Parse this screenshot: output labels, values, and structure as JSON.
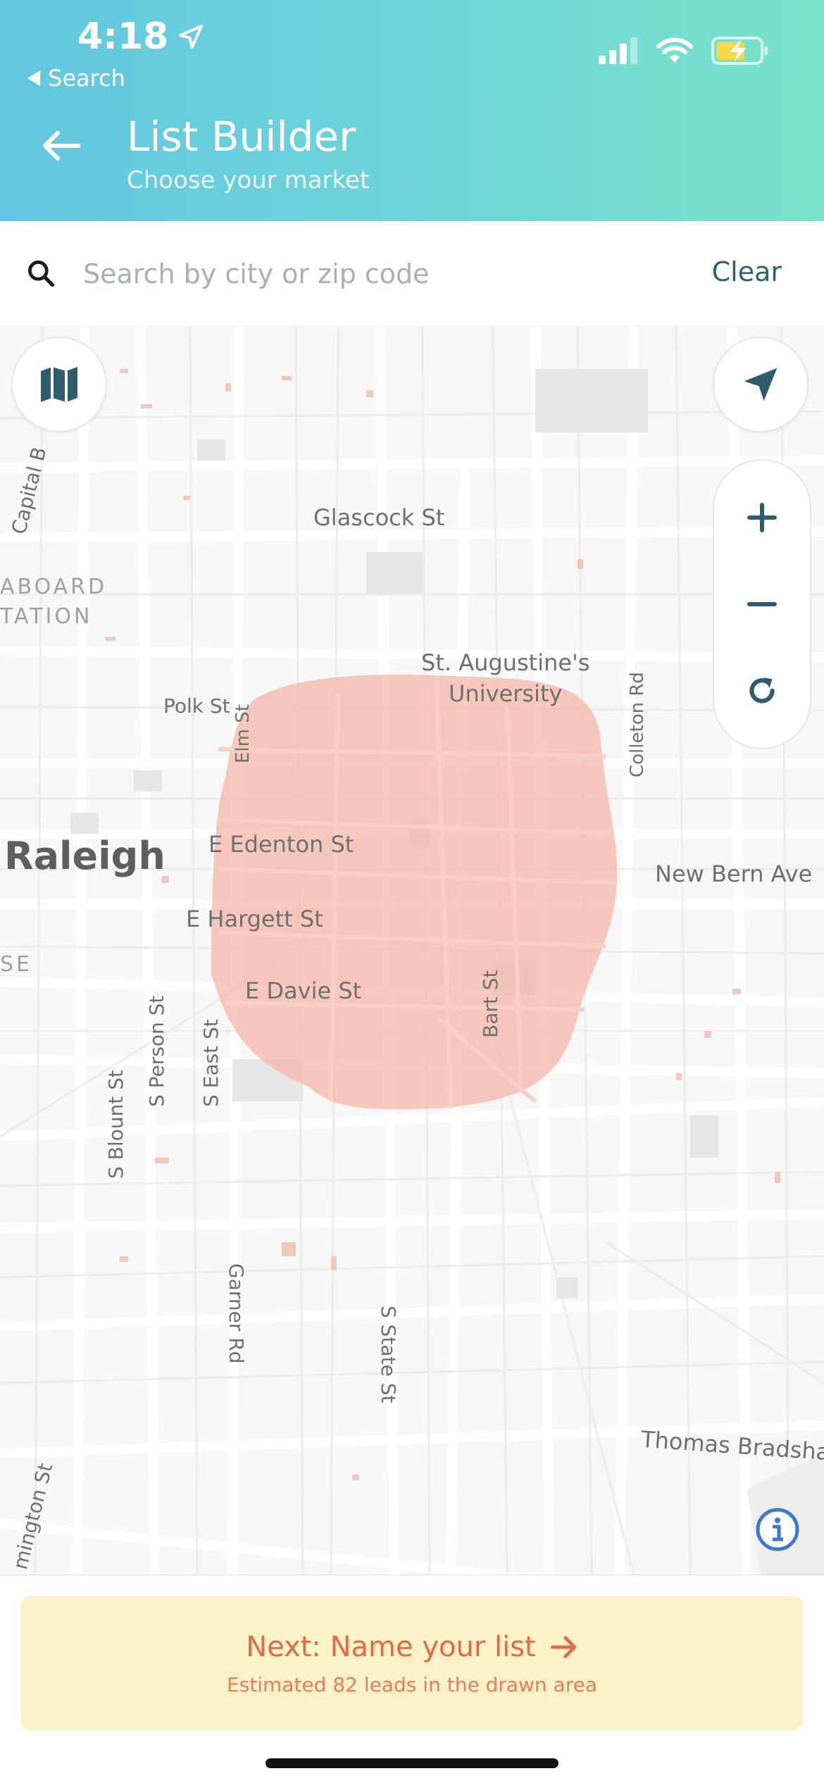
{
  "status": {
    "time": "4:18",
    "back_app": "Search",
    "icons": [
      "location-arrow-icon",
      "signal-icon",
      "wifi-icon",
      "battery-charging-icon"
    ]
  },
  "header": {
    "title": "List Builder",
    "subtitle": "Choose your market"
  },
  "search": {
    "placeholder": "Search by city or zip code",
    "value": "",
    "clear_label": "Clear"
  },
  "map": {
    "labels": {
      "glascock": "Glascock St",
      "staug1": "St. Augustine's",
      "staug2": "University",
      "polk": "Polk St",
      "elm": "Elm St",
      "colleton": "Colleton Rd",
      "raleigh": "Raleigh",
      "edenton": "E Edenton St",
      "newbern": "New Bern Ave",
      "hargett": "E Hargett St",
      "davie": "E Davie St",
      "bart": "Bart St",
      "blount": "S Blount St",
      "person": "S Person St",
      "east": "S East St",
      "garner": "Garner Rd",
      "state": "S State St",
      "thomas": "Thomas Bradsha",
      "wilmington": "mington St",
      "capital": "Capital B",
      "seaboard1": "ABOARD",
      "seaboard2": "TATION",
      "se": "SE"
    },
    "controls": [
      "map-layers-icon",
      "locate-me-icon",
      "zoom-in-icon",
      "zoom-out-icon",
      "reset-icon",
      "info-icon"
    ]
  },
  "footer": {
    "next_label": "Next: Name your list",
    "estimate": "Estimated 82 leads in the drawn area"
  },
  "colors": {
    "header_start": "#62c6e0",
    "header_end": "#79e2c8",
    "polygon": "#f4b7a8",
    "accent": "#e06b47",
    "footer_bg": "#fbf1c9",
    "control": "#2f5d6e"
  }
}
